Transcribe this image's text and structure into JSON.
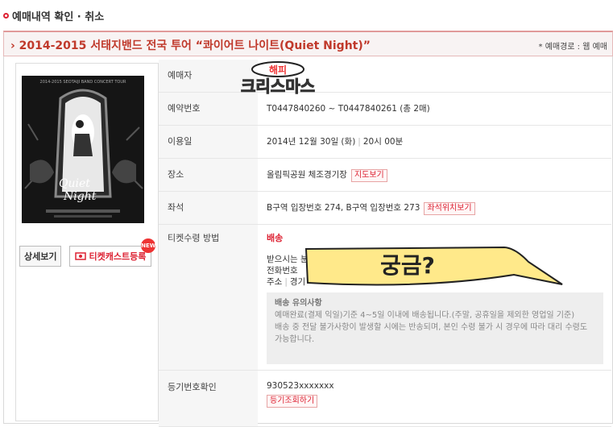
{
  "page_title": "예매내역 확인 · 취소",
  "show": {
    "title": "› 2014-2015 서태지밴드 전국 투어 “콰이어트 나이트(Quiet Night)”",
    "route": "* 예매경로 : 웹 예매"
  },
  "poster": {
    "top_text": "2014-2015 SEOTAIJI BAND CONCERT TOUR",
    "logo_line1": "Quiet",
    "logo_line2": "Night"
  },
  "buttons": {
    "detail": "상세보기",
    "ticketcast": "티켓캐스트등록",
    "new_badge": "NEW"
  },
  "sticker": {
    "line1": "해피",
    "line2": "크리스마스"
  },
  "bubble_text": "궁금?",
  "rows": {
    "booker": {
      "label": "예매자"
    },
    "reservation": {
      "label": "예약번호",
      "value": "T0447840260 ~ T0447840261 (총 2매)"
    },
    "date": {
      "label": "이용일",
      "day": "2014년 12월 30일 (화)",
      "time": "20시 00분"
    },
    "venue": {
      "label": "장소",
      "value": "올림픽공원 체조경기장",
      "button": "지도보기"
    },
    "seat": {
      "label": "좌석",
      "value": "B구역 입장번호 274, B구역 입장번호 273",
      "button": "좌석위치보기"
    },
    "method": {
      "label": "티켓수령 방법",
      "type": "배송",
      "recipient_label": "받으시는 분",
      "phone_label": "전화번호",
      "address_label": "주소",
      "address_prefix": "경기",
      "notice_title": "배송 유의사항",
      "notice_1": "예매완료(결제 익일)기준 4~5일 이내에 배송됩니다.(주말, 공휴일을 제외한 영업일 기준)",
      "notice_2": "배송 중 전달 불가사항이 발생할 시에는 반송되며, 본인 수령 불가 시 경우에 따라 대리 수령도 가능합니다."
    },
    "registration": {
      "label": "등기번호확인",
      "value": "930523xxxxxxx",
      "button": "등기조회하기"
    }
  }
}
